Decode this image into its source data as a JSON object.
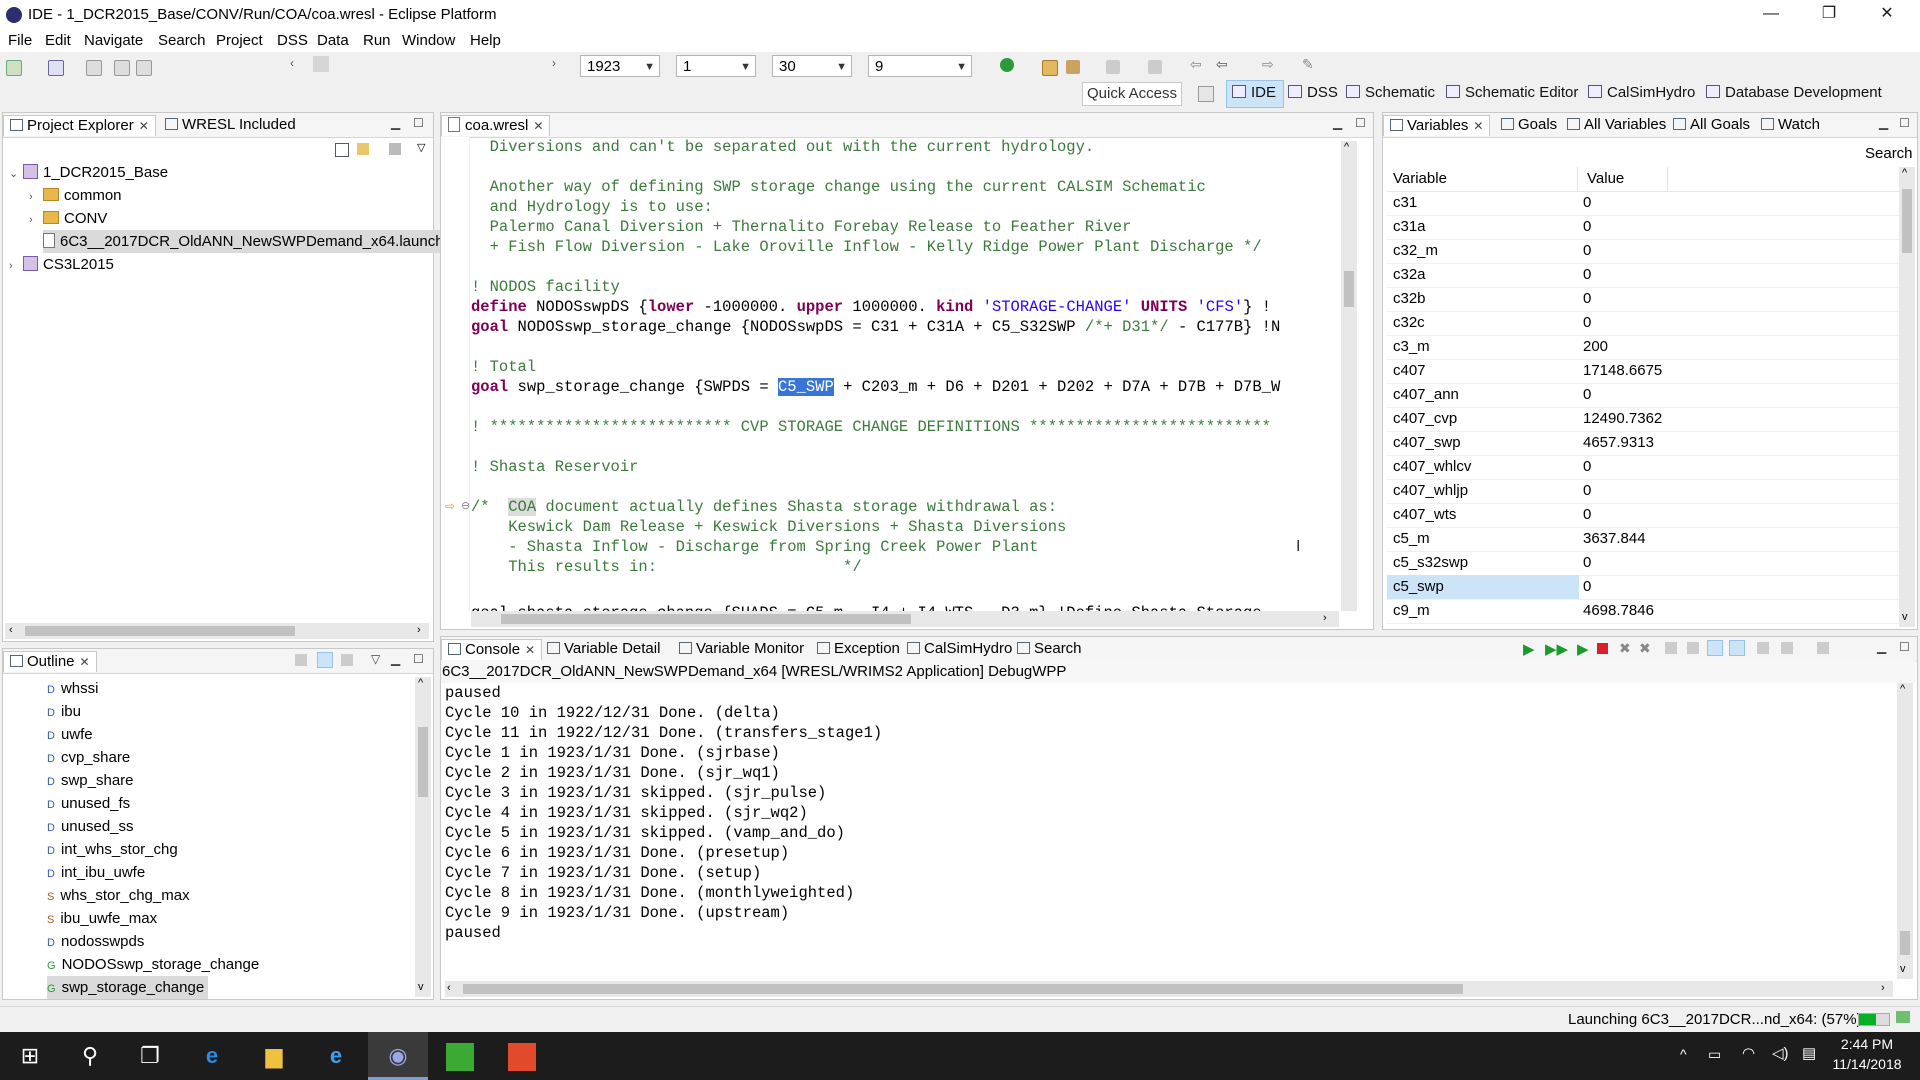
{
  "window": {
    "title": "IDE - 1_DCR2015_Base/CONV/Run/COA/coa.wresl - Eclipse Platform",
    "minimize": "—",
    "restore": "❐",
    "close": "✕"
  },
  "menu": [
    "File",
    "Edit",
    "Navigate",
    "Search",
    "Project",
    "DSS",
    "Data",
    "Run",
    "Window",
    "Help"
  ],
  "toolbar": {
    "combos": [
      {
        "value": "1923"
      },
      {
        "value": "1"
      },
      {
        "value": "30"
      },
      {
        "value": "9"
      }
    ],
    "quick_access": "Quick Access",
    "perspectives": [
      "IDE",
      "DSS",
      "Schematic",
      "Schematic Editor",
      "CalSimHydro",
      "Database Development"
    ]
  },
  "project_explorer": {
    "tabs": [
      "Project Explorer",
      "WRESL Included"
    ],
    "tree": [
      {
        "label": "1_DCR2015_Base",
        "twist": "v",
        "icon": "project"
      },
      {
        "label": "common",
        "twist": ">",
        "icon": "folder"
      },
      {
        "label": "CONV",
        "twist": ">",
        "icon": "folder"
      },
      {
        "label": "6C3__2017DCR_OldANN_NewSWPDemand_x64.launch",
        "twist": "",
        "icon": "file"
      },
      {
        "label": "CS3L2015",
        "twist": ">",
        "icon": "project"
      }
    ]
  },
  "outline": {
    "tab": "Outline",
    "items": [
      {
        "prefix": "D",
        "label": "whssi"
      },
      {
        "prefix": "D",
        "label": "ibu"
      },
      {
        "prefix": "D",
        "label": "uwfe"
      },
      {
        "prefix": "D",
        "label": "cvp_share"
      },
      {
        "prefix": "D",
        "label": "swp_share"
      },
      {
        "prefix": "D",
        "label": "unused_fs"
      },
      {
        "prefix": "D",
        "label": "unused_ss"
      },
      {
        "prefix": "D",
        "label": "int_whs_stor_chg"
      },
      {
        "prefix": "D",
        "label": "int_ibu_uwfe"
      },
      {
        "prefix": "S",
        "label": "whs_stor_chg_max"
      },
      {
        "prefix": "S",
        "label": "ibu_uwfe_max"
      },
      {
        "prefix": "D",
        "label": "nodosswpds"
      },
      {
        "prefix": "G",
        "label": "NODOSswp_storage_change"
      },
      {
        "prefix": "G",
        "label": "swp_storage_change"
      }
    ]
  },
  "editor": {
    "tab": "coa.wresl",
    "l01": "  Diversions and can't be separated out with the current hydrology.",
    "l02": "  Another way of defining SWP storage change using the current CALSIM Schematic",
    "l03": "  and Hydrology is to use:",
    "l04": "  Palermo Canal Diversion + Thernalito Forebay Release to Feather River",
    "l05": "  + Fish Flow Diversion - Lake Oroville Inflow - Kelly Ridge Power Plant Discharge */",
    "l06": "! NODOS facility",
    "l07a": "define",
    "l07b": " NODOSswpDS {",
    "l07c": "lower",
    "l07d": " -1000000. ",
    "l07e": "upper",
    "l07f": " 1000000. ",
    "l07g": "kind",
    "l07h": " ",
    "l07i": "'STORAGE-CHANGE'",
    "l07j": " ",
    "l07k": "UNITS",
    "l07l": " ",
    "l07m": "'CFS'",
    "l07n": "} !",
    "l08a": "goal",
    "l08b": " NODOSswp_storage_change {NODOSswpDS = C31 + C31A + C5_S32SWP ",
    "l08c": "/*+ D31*/",
    "l08d": " - C177B} !N",
    "l09": "! Total",
    "l10a": "goal",
    "l10b": " swp_storage_change {SWPDS = ",
    "l10c": "C5_SWP",
    "l10d": " + C203_m + D6 + D201 + D202 + D7A + D7B + D7B_W",
    "l11": "! ************************** CVP STORAGE CHANGE DEFINITIONS **************************",
    "l12": "! Shasta Reservoir",
    "l13a": "/*  ",
    "l13b": "COA",
    "l13c": " document actually defines Shasta storage withdrawal as:",
    "l14": "    Keswick Dam Release + Keswick Diversions + Shasta Diversions",
    "l15": "    - Shasta Inflow - Discharge from Spring Creek Power Plant",
    "l16": "    This results in:                    */",
    "l17": "goal shasta_storage_change {SHADS = C5_m - I4 + I4_WTS - D3_m} !Define Shasta Storage"
  },
  "variables": {
    "tabs": [
      "Variables",
      "Goals",
      "All Variables",
      "All Goals",
      "Watch"
    ],
    "search": "Search",
    "col_variable": "Variable",
    "col_value": "Value",
    "rows": [
      {
        "name": "c31",
        "value": "0"
      },
      {
        "name": "c31a",
        "value": "0"
      },
      {
        "name": "c32_m",
        "value": "0"
      },
      {
        "name": "c32a",
        "value": "0"
      },
      {
        "name": "c32b",
        "value": "0"
      },
      {
        "name": "c32c",
        "value": "0"
      },
      {
        "name": "c3_m",
        "value": "200"
      },
      {
        "name": "c407",
        "value": "17148.6675"
      },
      {
        "name": "c407_ann",
        "value": "0"
      },
      {
        "name": "c407_cvp",
        "value": "12490.7362"
      },
      {
        "name": "c407_swp",
        "value": "4657.9313"
      },
      {
        "name": "c407_whlcv",
        "value": "0"
      },
      {
        "name": "c407_whljp",
        "value": "0"
      },
      {
        "name": "c407_wts",
        "value": "0"
      },
      {
        "name": "c5_m",
        "value": "3637.844"
      },
      {
        "name": "c5_s32swp",
        "value": "0"
      },
      {
        "name": "c5_swp",
        "value": "0"
      },
      {
        "name": "c9_m",
        "value": "4698.7846"
      }
    ]
  },
  "console": {
    "tabs": [
      "Console",
      "Variable Detail",
      "Variable Monitor",
      "Exception",
      "CalSimHydro",
      "Search"
    ],
    "header": "6C3__2017DCR_OldANN_NewSWPDemand_x64 [WRESL/WRIMS2 Application] DebugWPP",
    "lines": [
      "paused",
      "Cycle 10 in 1922/12/31 Done. (delta)",
      "Cycle 11 in 1922/12/31 Done. (transfers_stage1)",
      "Cycle 1 in 1923/1/31 Done. (sjrbase)",
      "Cycle 2 in 1923/1/31 Done. (sjr_wq1)",
      "Cycle 3 in 1923/1/31 skipped. (sjr_pulse)",
      "Cycle 4 in 1923/1/31 skipped. (sjr_wq2)",
      "Cycle 5 in 1923/1/31 skipped. (vamp_and_do)",
      "Cycle 6 in 1923/1/31 Done. (presetup)",
      "Cycle 7 in 1923/1/31 Done. (setup)",
      "Cycle 8 in 1923/1/31 Done. (monthlyweighted)",
      "Cycle 9 in 1923/1/31 Done. (upstream)",
      "paused"
    ]
  },
  "status": {
    "text": "Launching 6C3__2017DCR...nd_x64: (57%)",
    "progress": 0.57
  },
  "taskbar": {
    "time": "2:44 PM",
    "date": "11/14/2018"
  },
  "colors": {
    "comment": "#3c7a3c",
    "keyword": "#7f0055",
    "string": "#2a00ff",
    "selection": "#3875d7",
    "taskbar": "#1c1c1c",
    "progress": "#06b025"
  }
}
